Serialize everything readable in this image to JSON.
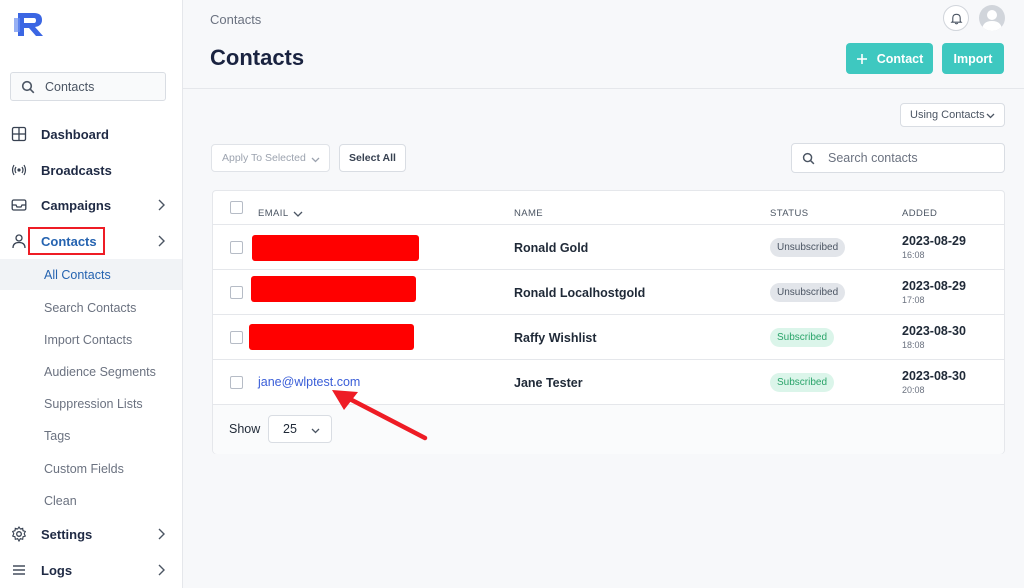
{
  "sidebar": {
    "search_value": "Contacts",
    "nav": [
      {
        "label": "Dashboard",
        "icon": "dashboard-icon"
      },
      {
        "label": "Broadcasts",
        "icon": "broadcast-icon"
      },
      {
        "label": "Campaigns",
        "icon": "inbox-icon"
      },
      {
        "label": "Contacts",
        "icon": "user-icon"
      },
      {
        "label": "Settings",
        "icon": "gear-icon"
      },
      {
        "label": "Logs",
        "icon": "list-icon"
      }
    ],
    "submenu": [
      "All Contacts",
      "Search Contacts",
      "Import Contacts",
      "Audience Segments",
      "Suppression Lists",
      "Tags",
      "Custom Fields",
      "Clean"
    ],
    "active_submenu": "All Contacts"
  },
  "header": {
    "breadcrumb": "Contacts",
    "title": "Contacts",
    "add_contact_label": "Contact",
    "import_label": "Import"
  },
  "toolbar": {
    "using_select": "Using Contacts",
    "apply_placeholder": "Apply To Selected",
    "select_all_label": "Select All",
    "search_placeholder": "Search contacts"
  },
  "table": {
    "columns": [
      "EMAIL",
      "NAME",
      "STATUS",
      "ADDED"
    ],
    "rows": [
      {
        "email": "",
        "name": "Ronald Gold",
        "status": "Unsubscribed",
        "date": "2023-08-29",
        "time": "16:08"
      },
      {
        "email": "",
        "name": "Ronald Localhostgold",
        "status": "Unsubscribed",
        "date": "2023-08-29",
        "time": "17:08"
      },
      {
        "email": "",
        "name": "Raffy Wishlist",
        "status": "Subscribed",
        "date": "2023-08-30",
        "time": "18:08"
      },
      {
        "email": "jane@wlptest.com",
        "name": "Jane Tester",
        "status": "Subscribed",
        "date": "2023-08-30",
        "time": "20:08"
      }
    ],
    "show_label": "Show",
    "page_size": "25"
  },
  "colors": {
    "accent": "#3ec8c0",
    "annotation_red": "#ff0000",
    "link_blue": "#3a5ed8"
  }
}
